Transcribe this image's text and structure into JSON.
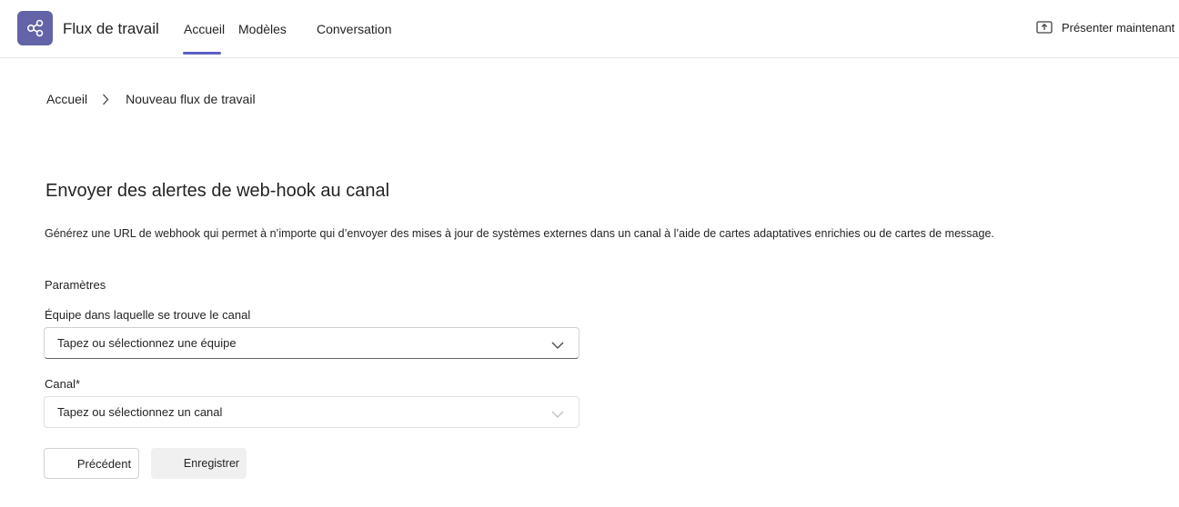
{
  "header": {
    "app_icon": "workflow-share-icon",
    "app_title": "Flux de travail",
    "tabs": [
      {
        "label": "Accueil",
        "active": true
      },
      {
        "label": "Modèles",
        "active": false
      },
      {
        "label": "Conversation",
        "active": false
      }
    ],
    "present_label": "Présenter maintenant",
    "accent_color": "#5b5fc7",
    "app_icon_color": "#6264a7"
  },
  "breadcrumb": {
    "home": "Accueil",
    "current": "Nouveau flux de travail"
  },
  "main": {
    "title": "Envoyer des alertes de web-hook au canal",
    "description": "Générez une URL de webhook qui permet à n’importe qui d’envoyer des mises à jour de systèmes externes dans un canal à l’aide de cartes adaptatives enrichies ou de cartes de message.",
    "section_label": "Paramètres",
    "team_field": {
      "label": "Équipe dans laquelle se trouve le canal",
      "value": "Tapez ou sélectionnez une équipe"
    },
    "channel_field": {
      "label": "Canal*",
      "value": "Tapez ou sélectionnez un canal"
    },
    "buttons": {
      "previous": "Précédent",
      "save": "Enregistrer"
    }
  }
}
